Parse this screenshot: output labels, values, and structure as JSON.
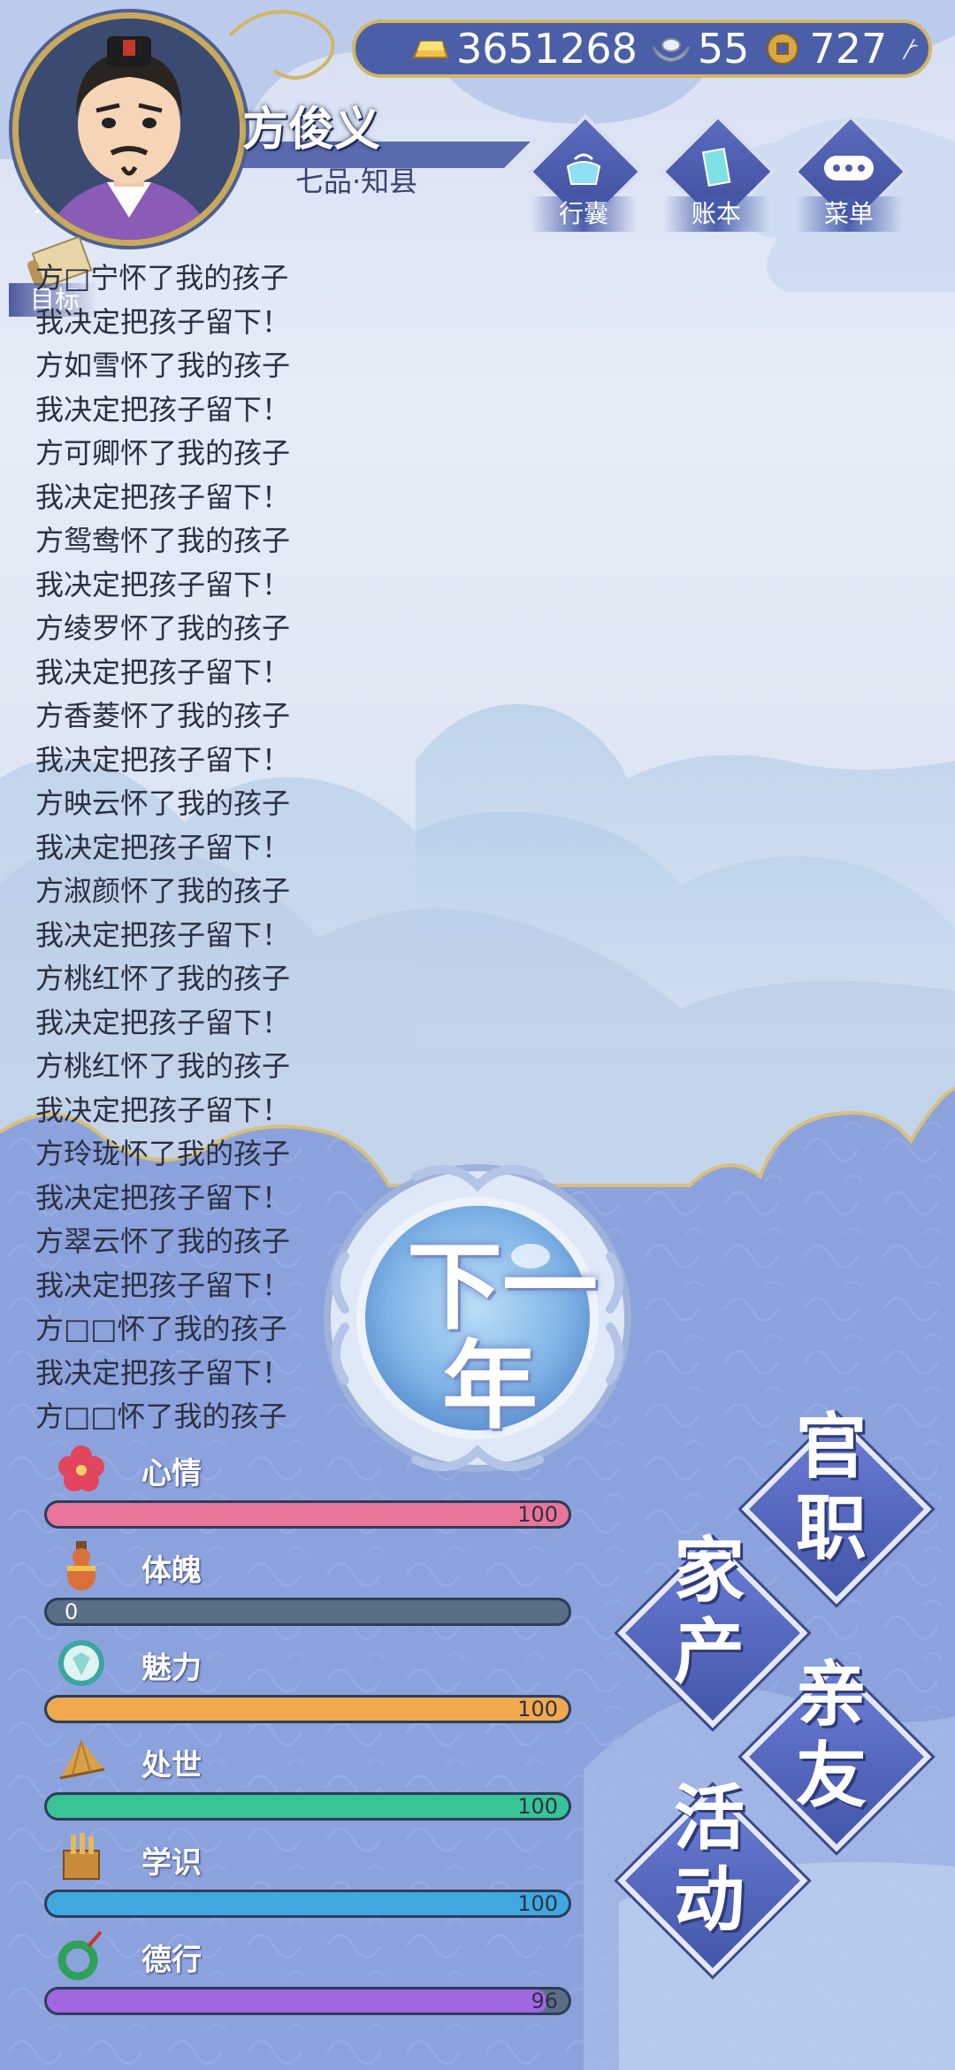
{
  "player": {
    "name": "方俊义",
    "rank": "七品·知县"
  },
  "currency": {
    "gold": "3651268",
    "silver": "55",
    "coin": "727"
  },
  "top_menu": [
    {
      "label": "行囊",
      "icon": "bag-icon"
    },
    {
      "label": "账本",
      "icon": "ledger-icon"
    },
    {
      "label": "菜单",
      "icon": "more-icon"
    }
  ],
  "goal_label": "目标",
  "log": [
    "方□宁怀了我的孩子",
    "我决定把孩子留下！",
    "方如雪怀了我的孩子",
    "我决定把孩子留下！",
    "方可卿怀了我的孩子",
    "我决定把孩子留下！",
    "方鸳鸯怀了我的孩子",
    "我决定把孩子留下！",
    "方绫罗怀了我的孩子",
    "我决定把孩子留下！",
    "方香菱怀了我的孩子",
    "我决定把孩子留下！",
    "方映云怀了我的孩子",
    "我决定把孩子留下！",
    "方淑颜怀了我的孩子",
    "我决定把孩子留下！",
    "方桃红怀了我的孩子",
    "我决定把孩子留下！",
    "方桃红怀了我的孩子",
    "我决定把孩子留下！",
    "方玲珑怀了我的孩子",
    "我决定把孩子留下！",
    "方翠云怀了我的孩子",
    "我决定把孩子留下！",
    "方□□怀了我的孩子",
    "我决定把孩子留下！",
    "方□□怀了我的孩子"
  ],
  "next_year": {
    "line1": "下一",
    "line2": "年"
  },
  "stats": [
    {
      "name": "心情",
      "value": "100",
      "fill": 1.0,
      "color": "#e9759a",
      "icon": "flower-icon"
    },
    {
      "name": "体魄",
      "value": "0",
      "fill": 0.0,
      "color": "#5a6e86",
      "icon": "gourd-icon"
    },
    {
      "name": "魅力",
      "value": "100",
      "fill": 1.0,
      "color": "#f0a94e",
      "icon": "mirror-icon"
    },
    {
      "name": "处世",
      "value": "100",
      "fill": 1.0,
      "color": "#38c494",
      "icon": "fan-icon"
    },
    {
      "name": "学识",
      "value": "100",
      "fill": 1.0,
      "color": "#3fa8e0",
      "icon": "brush-pot-icon"
    },
    {
      "name": "德行",
      "value": "96",
      "fill": 0.96,
      "color": "#a166e0",
      "icon": "jade-icon"
    }
  ],
  "main_menu": {
    "office": "官职",
    "estate": "家产",
    "relatives": "亲友",
    "events": "活动"
  }
}
